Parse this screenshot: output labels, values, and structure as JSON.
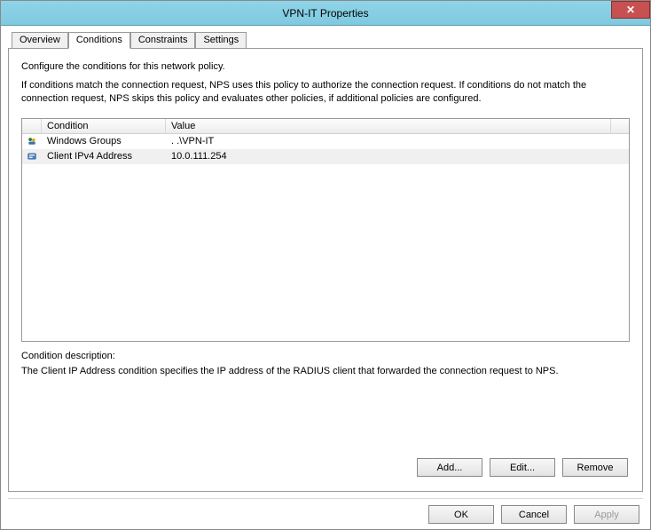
{
  "window": {
    "title": "VPN-IT Properties"
  },
  "tabs": {
    "items": [
      {
        "label": "Overview"
      },
      {
        "label": "Conditions"
      },
      {
        "label": "Constraints"
      },
      {
        "label": "Settings"
      }
    ],
    "active_index": 1
  },
  "panel": {
    "intro1": "Configure the conditions for this network policy.",
    "intro2": "If conditions match the connection request, NPS uses this policy to authorize the connection request. If conditions do not match the connection request, NPS skips this policy and evaluates other policies, if additional policies are configured."
  },
  "listview": {
    "headers": {
      "condition": "Condition",
      "value": "Value"
    },
    "rows": [
      {
        "icon": "group-icon",
        "condition": "Windows Groups",
        "value": ". .\\VPN-IT",
        "selected": false
      },
      {
        "icon": "ip-icon",
        "condition": "Client IPv4 Address",
        "value": "10.0.111.254",
        "selected": true
      }
    ]
  },
  "description": {
    "label": "Condition description:",
    "text": "The Client IP Address condition specifies the IP address of the RADIUS client that forwarded the connection request to NPS."
  },
  "buttons": {
    "add": "Add...",
    "edit": "Edit...",
    "remove": "Remove",
    "ok": "OK",
    "cancel": "Cancel",
    "apply": "Apply"
  }
}
